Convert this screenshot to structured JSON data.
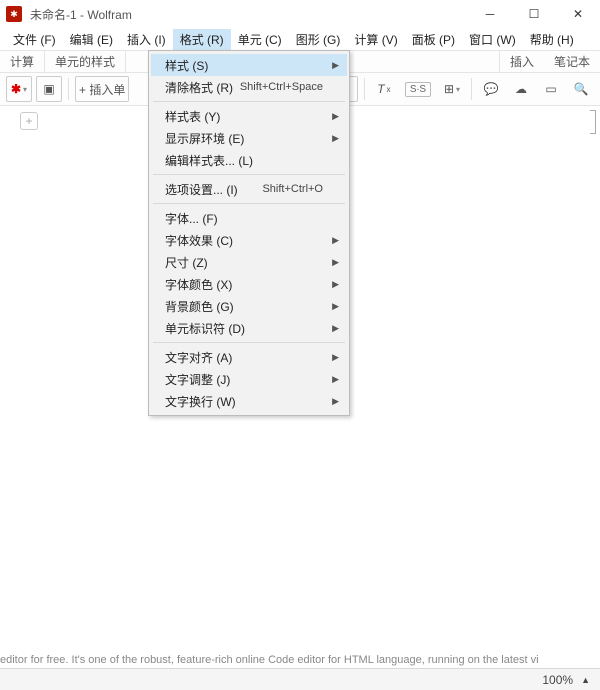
{
  "window": {
    "doc": "未命名-1",
    "app": "Wolfram"
  },
  "menubar": [
    "文件 (F)",
    "编辑 (E)",
    "插入 (I)",
    "格式 (R)",
    "单元 (C)",
    "图形 (G)",
    "计算 (V)",
    "面板 (P)",
    "窗口 (W)",
    "帮助 (H)"
  ],
  "menubar_active_index": 3,
  "toolbar_labels": {
    "calc": "计算",
    "cellstyle": "单元的样式",
    "insert": "插入",
    "notebook": "笔记本"
  },
  "insert_btn": "+ 插入单",
  "dropmenu": [
    {
      "label": "样式 (S)",
      "submenu": true,
      "highlight": true
    },
    {
      "label": "清除格式 (R)",
      "shortcut": "Shift+Ctrl+Space"
    },
    {
      "sep": true
    },
    {
      "label": "样式表 (Y)",
      "submenu": true
    },
    {
      "label": "显示屏环境 (E)",
      "submenu": true
    },
    {
      "label": "编辑样式表... (L)"
    },
    {
      "sep": true
    },
    {
      "label": "选项设置... (I)",
      "shortcut": "Shift+Ctrl+O"
    },
    {
      "sep": true
    },
    {
      "label": "字体... (F)"
    },
    {
      "label": "字体效果 (C)",
      "submenu": true
    },
    {
      "label": "尺寸 (Z)",
      "submenu": true
    },
    {
      "label": "字体颜色 (X)",
      "submenu": true
    },
    {
      "label": "背景颜色 (G)",
      "submenu": true
    },
    {
      "label": "单元标识符 (D)",
      "submenu": true
    },
    {
      "sep": true
    },
    {
      "label": "文字对齐 (A)",
      "submenu": true
    },
    {
      "label": "文字调整 (J)",
      "submenu": true
    },
    {
      "label": "文字换行 (W)",
      "submenu": true
    }
  ],
  "status": {
    "zoom": "100%"
  },
  "ss_label": "S∙S",
  "bgtext": "editor for free. It's one of the robust, feature-rich online Code editor for HTML language, running on the latest vi"
}
